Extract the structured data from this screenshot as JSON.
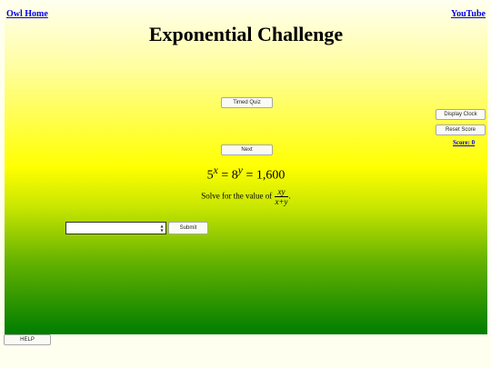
{
  "links": {
    "home": "Owl Home",
    "youtube": "YouTube"
  },
  "title": "Exponential Challenge",
  "buttons": {
    "timed_quiz": "Timed Quiz",
    "next": "Next",
    "display_clock": "Display Clock",
    "reset_score": "Reset Score",
    "submit": "Submit",
    "help": "HELP"
  },
  "score": "Score: 0",
  "problem": {
    "base_a": "5",
    "exp_a": "x",
    "base_b": "8",
    "exp_b": "y",
    "value": "1,600",
    "prompt": "Solve for the value of",
    "numerator": "xy",
    "denominator": "x+y"
  },
  "answer": {
    "value": "",
    "placeholder": ""
  },
  "icons": {
    "spinner_up": "spin-up-icon",
    "spinner_down": "spin-down-icon"
  }
}
